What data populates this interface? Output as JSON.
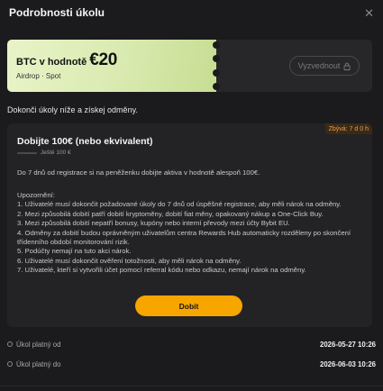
{
  "dialog": {
    "title": "Podrobnosti úkolu"
  },
  "voucher": {
    "label": "BTC v hodnotě",
    "amount": "€20",
    "subtitle": "Airdrop · Spot",
    "claim_label": "Vyzvednout"
  },
  "instruction": "Dokonči úkoly níže a získej odměny.",
  "task": {
    "deadline": "Zbývá: 7 d 0 h",
    "title": "Dobijte 100€ (nebo ekvivalent)",
    "progress_text": "Ještě 100 €",
    "progress_fraction": 0,
    "description": "Do 7 dnů od registrace si na peněženku dobijte aktiva v hodnotě alespoň 100€.",
    "notes_heading": "Upozornění:",
    "notes": [
      "1. Uživatelé musí dokončit požadované úkoly do 7 dnů od úspěšné registrace, aby měli nárok na odměny.",
      "2. Mezi způsobilá dobití patří dobití kryptoměny, dobití fiat měny, opakovaný nákup a One-Click Buy.",
      "3. Mezi způsobilá dobití nepatří bonusy, kupóny nebo interní převody mezi účty Bybit EU.",
      "4. Odměny za dobití budou oprávněným uživatelům centra Rewards Hub automaticky rozděleny po skončení třídenního období monitorování rizik.",
      "5. Podúčty nemají na tuto akci nárok.",
      "6. Uživatelé musí dokončit ověření totožnosti, aby měli nárok na odměny.",
      "7. Uživatelé, kteří si vytvořili účet pomocí referral kódu nebo odkazu, nemají nárok na odměny."
    ],
    "button_label": "Dobít"
  },
  "validity": {
    "from_label": "Úkol platný od",
    "from_value": "2026-05-27 10:26",
    "to_label": "Úkol platný do",
    "to_value": "2026-06-03 10:26"
  },
  "colors": {
    "accent": "#f7a600",
    "background": "#1b1b1d",
    "card": "#232325",
    "deadline": "#e8a04a"
  }
}
